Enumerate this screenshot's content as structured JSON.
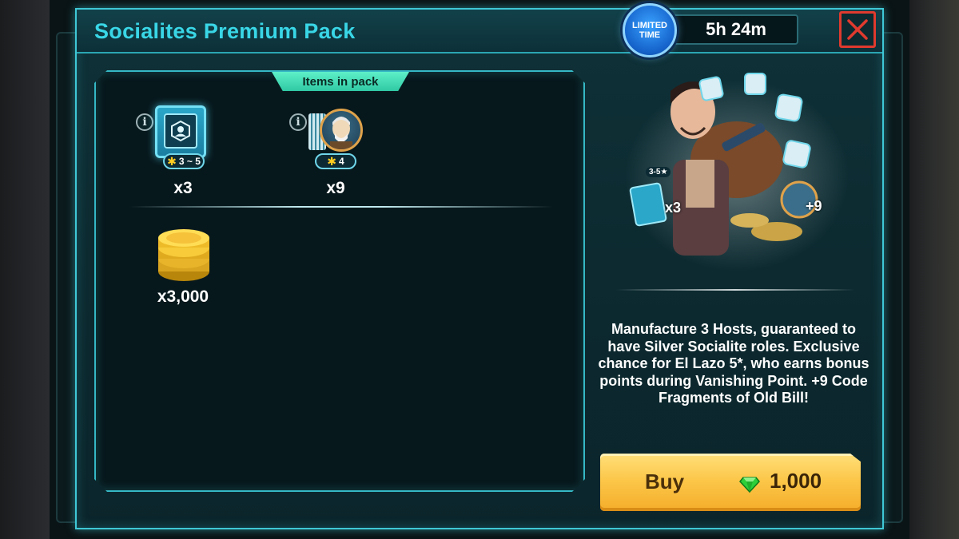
{
  "modal": {
    "title": "Socialites Premium Pack",
    "limited_badge": "LIMITED TIME",
    "timer": "5h 24m",
    "close_icon": "close-x-icon"
  },
  "items_panel": {
    "tab_label": "Items in pack",
    "items": [
      {
        "name": "host-card-pack",
        "stars": "3 ~ 5",
        "quantity": "x3",
        "icon": "host-card-icon"
      },
      {
        "name": "old-bill-code-fragments",
        "stars": "4",
        "quantity": "x9",
        "icon": "portrait-fragment-icon"
      },
      {
        "name": "gold-coins",
        "quantity": "x3,000",
        "icon": "coin-stack-icon"
      }
    ]
  },
  "hero_art": {
    "card_badge": "3-5★",
    "card_count": "x3",
    "fragment_count": "+9"
  },
  "description": "Manufacture 3 Hosts, guaranteed to have Silver Socialite roles. Exclusive chance for El Lazo 5*, who earns bonus points during Vanishing Point. +9 Code Fragments of Old Bill!",
  "buy": {
    "label": "Buy",
    "price": "1,000",
    "currency_icon": "green-gem-icon"
  },
  "colors": {
    "title": "#39d6e6",
    "border": "#3fc8d6",
    "tab": "#3fdcb5",
    "buy_button": "#fcc74a",
    "close": "#e03a2e"
  }
}
